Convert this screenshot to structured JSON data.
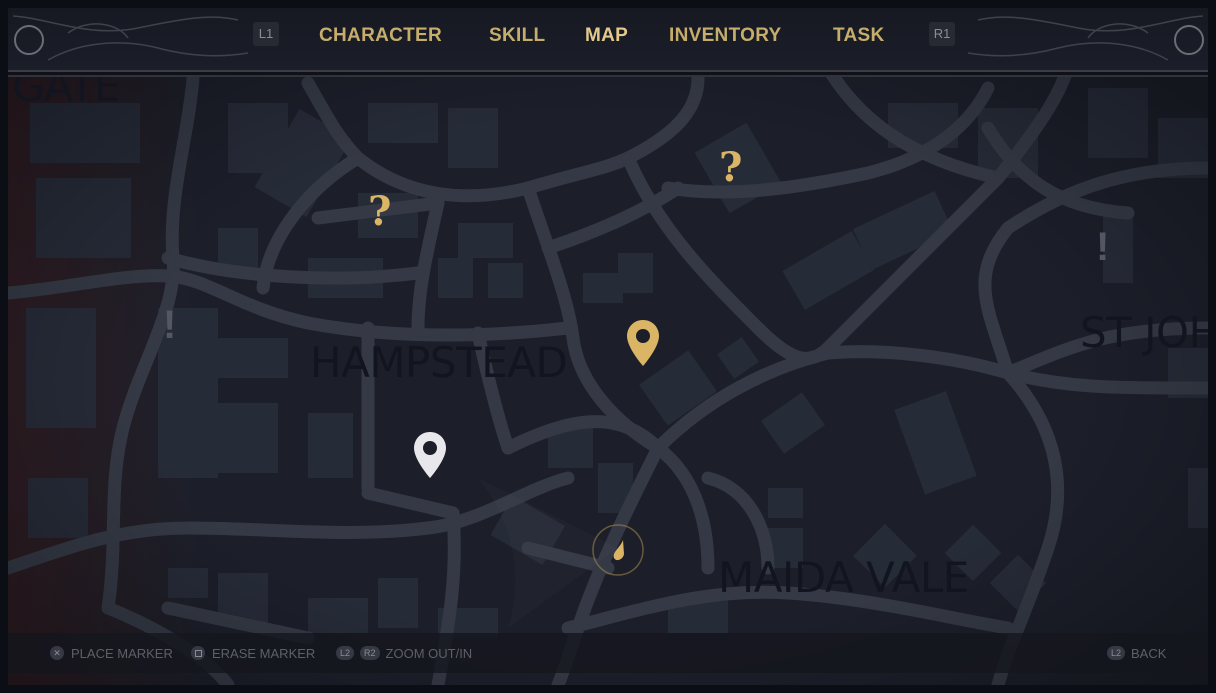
{
  "nav": {
    "left_shoulder": "L1",
    "right_shoulder": "R1",
    "tabs": [
      {
        "label": "CHARACTER",
        "active": false
      },
      {
        "label": "SKILL",
        "active": false
      },
      {
        "label": "MAP",
        "active": true
      },
      {
        "label": "INVENTORY",
        "active": false
      },
      {
        "label": "TASK",
        "active": false
      }
    ]
  },
  "map": {
    "districts": {
      "top_left_partial": "GATE",
      "hampstead": "HAMPSTEAD",
      "maida_vale": "MAIDA VALE",
      "st_john_partial": "ST JOHN"
    },
    "markers": {
      "unknown_symbol": "?",
      "alert_symbol": "!"
    },
    "colors": {
      "accent_gold": "#d9b565",
      "player_marker": "#e8e8ec",
      "building": "#262b38",
      "road": "#343945"
    }
  },
  "controls": {
    "place_marker": {
      "button": "✕",
      "label": "PLACE MARKER"
    },
    "erase_marker": {
      "button": "□",
      "label": "ERASE MARKER"
    },
    "zoom": {
      "button_left": "L2",
      "button_right": "R2",
      "label": "ZOOM OUT/IN"
    },
    "back": {
      "button": "L2",
      "label": "BACK"
    }
  }
}
